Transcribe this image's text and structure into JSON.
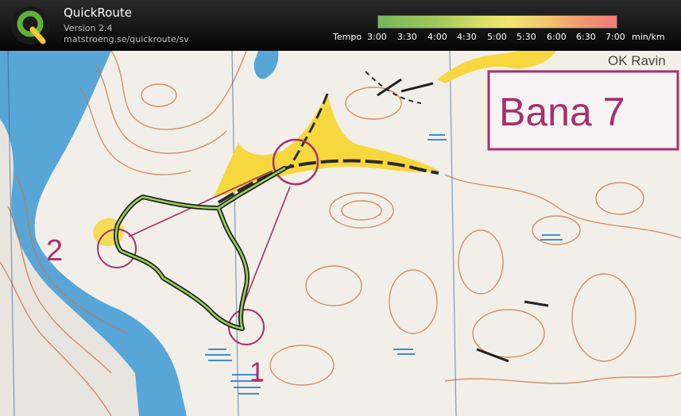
{
  "app": {
    "title": "QuickRoute",
    "version": "Version 2.4",
    "url": "matstroeng.se/quickroute/sv",
    "logo_icon": "quickroute-logo-icon"
  },
  "tempo": {
    "label": "Tempo",
    "ticks": [
      "3:00",
      "3:30",
      "4:00",
      "4:30",
      "5:00",
      "5:30",
      "6:00",
      "6:30",
      "7:00"
    ],
    "unit": "min/km",
    "colors": [
      "#72b85a",
      "#dfe168",
      "#f2c86d",
      "#ef7b7b"
    ]
  },
  "map": {
    "course_label": "Bana 7",
    "club_label": "OK Ravin",
    "control_numbers": [
      "1",
      "2"
    ],
    "colors": {
      "water": "#58a6d8",
      "contour": "#c9774a",
      "open_land": "#f6d83e",
      "course": "#a8306a",
      "route_outline": "#1d1d1d",
      "route_fill": "#9bd15b"
    }
  }
}
